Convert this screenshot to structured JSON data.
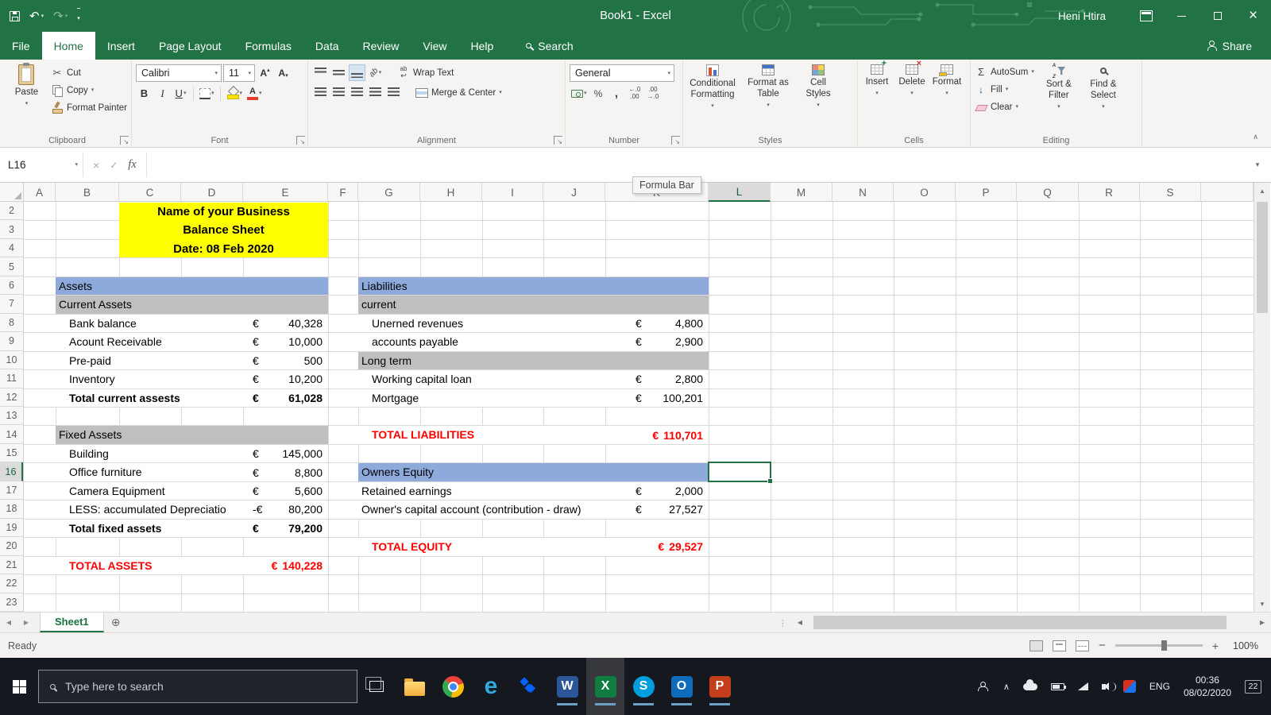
{
  "titlebar": {
    "title": "Book1 - Excel",
    "user": "Heni Htira"
  },
  "tabs": {
    "items": [
      "File",
      "Home",
      "Insert",
      "Page Layout",
      "Formulas",
      "Data",
      "Review",
      "View",
      "Help"
    ],
    "active": "Home",
    "search": "Search",
    "share": "Share"
  },
  "ribbon": {
    "clipboard": {
      "label": "Clipboard",
      "paste": "Paste",
      "cut": "Cut",
      "copy": "Copy",
      "format_painter": "Format Painter"
    },
    "font": {
      "label": "Font",
      "name": "Calibri",
      "size": "11"
    },
    "alignment": {
      "label": "Alignment",
      "wrap": "Wrap Text",
      "merge": "Merge & Center"
    },
    "number": {
      "label": "Number",
      "format": "General"
    },
    "styles": {
      "label": "Styles",
      "conditional": "Conditional Formatting",
      "format_table": "Format as Table",
      "cell_styles": "Cell Styles"
    },
    "cells": {
      "label": "Cells",
      "insert": "Insert",
      "delete": "Delete",
      "format": "Format"
    },
    "editing": {
      "label": "Editing",
      "autosum": "AutoSum",
      "fill": "Fill",
      "clear": "Clear",
      "sort_filter": "Sort & Filter",
      "find_select": "Find & Select"
    }
  },
  "formula_bar": {
    "name_box": "L16",
    "fx": "fx",
    "tooltip": "Formula Bar"
  },
  "sheet": {
    "columns": [
      "A",
      "B",
      "C",
      "D",
      "E",
      "F",
      "G",
      "H",
      "I",
      "J",
      "K",
      "L",
      "M",
      "N",
      "O",
      "P",
      "Q",
      "R",
      "S"
    ],
    "rows": [
      2,
      3,
      4,
      5,
      6,
      7,
      8,
      9,
      10,
      11,
      12,
      13,
      14,
      15,
      16,
      17,
      18,
      19,
      20,
      21,
      22,
      23
    ],
    "active_cell": "L16",
    "cells": [
      {
        "start": "C",
        "end": "E",
        "row": 2,
        "rowspan": 3,
        "cls": "yellow",
        "lines": [
          "Name of your Business",
          "Balance Sheet",
          "Date: 08 Feb 2020"
        ]
      },
      {
        "start": "B",
        "end": "E",
        "row": 6,
        "cls": "blue",
        "text": "Assets"
      },
      {
        "start": "B",
        "end": "E",
        "row": 7,
        "cls": "gray",
        "text": "Current Assets"
      },
      {
        "start": "B",
        "end": "D",
        "row": 8,
        "cls": "item",
        "text": "Bank balance"
      },
      {
        "start": "E",
        "row": 8,
        "cls": "money",
        "cur": "€",
        "val": "40,328"
      },
      {
        "start": "B",
        "end": "D",
        "row": 9,
        "cls": "item",
        "text": "Acount Receivable"
      },
      {
        "start": "E",
        "row": 9,
        "cls": "money",
        "cur": "€",
        "val": "10,000"
      },
      {
        "start": "B",
        "end": "D",
        "row": 10,
        "cls": "item",
        "text": "Pre-paid"
      },
      {
        "start": "E",
        "row": 10,
        "cls": "money",
        "cur": "€",
        "val": "500"
      },
      {
        "start": "B",
        "end": "D",
        "row": 11,
        "cls": "item",
        "text": "Inventory"
      },
      {
        "start": "E",
        "row": 11,
        "cls": "money",
        "cur": "€",
        "val": "10,200"
      },
      {
        "start": "B",
        "end": "D",
        "row": 12,
        "cls": "item bold",
        "text": "Total current assests"
      },
      {
        "start": "E",
        "row": 12,
        "cls": "money bold",
        "cur": "€",
        "val": "61,028"
      },
      {
        "start": "B",
        "end": "E",
        "row": 14,
        "cls": "gray",
        "text": "Fixed Assets"
      },
      {
        "start": "B",
        "end": "D",
        "row": 15,
        "cls": "item",
        "text": "Building"
      },
      {
        "start": "E",
        "row": 15,
        "cls": "money",
        "cur": "€",
        "val": "145,000"
      },
      {
        "start": "B",
        "end": "D",
        "row": 16,
        "cls": "item",
        "text": "Office furniture"
      },
      {
        "start": "E",
        "row": 16,
        "cls": "money",
        "cur": "€",
        "val": "8,800"
      },
      {
        "start": "B",
        "end": "D",
        "row": 17,
        "cls": "item",
        "text": "Camera Equipment"
      },
      {
        "start": "E",
        "row": 17,
        "cls": "money",
        "cur": "€",
        "val": "5,600"
      },
      {
        "start": "B",
        "end": "D",
        "row": 18,
        "cls": "item",
        "text": "LESS: accumulated Depreciatio"
      },
      {
        "start": "E",
        "row": 18,
        "cls": "money",
        "cur": "-€",
        "val": "80,200"
      },
      {
        "start": "B",
        "end": "D",
        "row": 19,
        "cls": "item bold",
        "text": "Total fixed assets"
      },
      {
        "start": "E",
        "row": 19,
        "cls": "money bold",
        "cur": "€",
        "val": "79,200"
      },
      {
        "start": "B",
        "end": "D",
        "row": 21,
        "cls": "item red bold",
        "text": "TOTAL ASSETS"
      },
      {
        "start": "E",
        "row": 21,
        "cls": "money tight red bold",
        "cur": "€",
        "val": "140,228"
      },
      {
        "start": "G",
        "end": "K",
        "row": 6,
        "cls": "blue",
        "text": "Liabilities"
      },
      {
        "start": "G",
        "end": "K",
        "row": 7,
        "cls": "gray",
        "text": "current"
      },
      {
        "start": "G",
        "end": "J",
        "row": 8,
        "cls": "item",
        "text": "Unerned revenues"
      },
      {
        "start": "K",
        "row": 8,
        "cls": "money k",
        "cur": "€",
        "val": "4,800"
      },
      {
        "start": "G",
        "end": "J",
        "row": 9,
        "cls": "item",
        "text": "accounts payable"
      },
      {
        "start": "K",
        "row": 9,
        "cls": "money k",
        "cur": "€",
        "val": "2,900"
      },
      {
        "start": "G",
        "end": "K",
        "row": 10,
        "cls": "gray",
        "text": "Long term"
      },
      {
        "start": "G",
        "end": "J",
        "row": 11,
        "cls": "item",
        "text": "Working capital loan"
      },
      {
        "start": "K",
        "row": 11,
        "cls": "money k",
        "cur": "€",
        "val": "2,800"
      },
      {
        "start": "G",
        "end": "J",
        "row": 12,
        "cls": "item",
        "text": "Mortgage"
      },
      {
        "start": "K",
        "row": 12,
        "cls": "money k",
        "cur": "€",
        "val": "100,201"
      },
      {
        "start": "G",
        "end": "J",
        "row": 14,
        "cls": "item red bold",
        "text": "TOTAL LIABILITIES"
      },
      {
        "start": "K",
        "row": 14,
        "cls": "money k tight red bold",
        "cur": "€",
        "val": "110,701"
      },
      {
        "start": "G",
        "end": "K",
        "row": 16,
        "cls": "blue",
        "text": "Owners Equity"
      },
      {
        "start": "G",
        "end": "J",
        "row": 17,
        "cls": "plain",
        "text": "Retained earnings"
      },
      {
        "start": "K",
        "row": 17,
        "cls": "money k",
        "cur": "€",
        "val": "2,000"
      },
      {
        "start": "G",
        "end": "J",
        "row": 18,
        "cls": "plain",
        "text": "Owner's capital account (contribution - draw)"
      },
      {
        "start": "K",
        "row": 18,
        "cls": "money k",
        "cur": "€",
        "val": "27,527"
      },
      {
        "start": "G",
        "end": "J",
        "row": 20,
        "cls": "item red bold",
        "text": "TOTAL EQUITY"
      },
      {
        "start": "K",
        "row": 20,
        "cls": "money k tight red bold",
        "cur": "€",
        "val": "29,527"
      }
    ]
  },
  "sheet_tabs": {
    "name": "Sheet1"
  },
  "status": {
    "ready": "Ready",
    "zoom": "100%"
  },
  "taskbar": {
    "search": "Type here to search",
    "lang": "ENG",
    "time": "00:36",
    "date": "08/02/2020",
    "badge": "22"
  }
}
